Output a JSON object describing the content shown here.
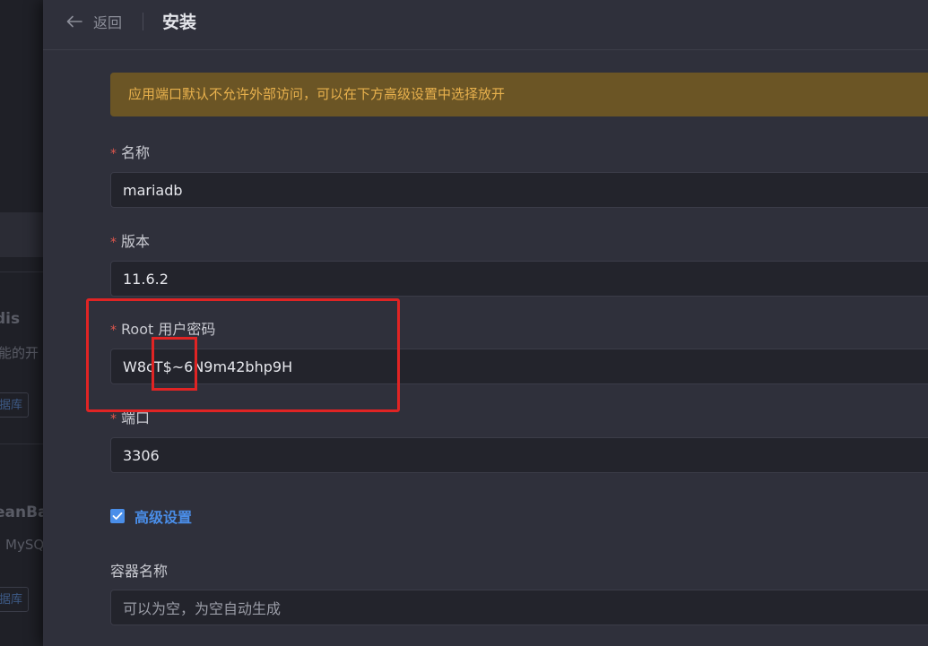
{
  "background_page": {
    "item1_title": "dis",
    "item1_desc": "能的开",
    "item1_tag": "据库",
    "item2_title": "eanBa",
    "item2_desc": "MySQ",
    "item2_tag": "据库"
  },
  "header": {
    "back_label": "返回",
    "title": "安装"
  },
  "alert": {
    "text": "应用端口默认不允许外部访问，可以在下方高级设置中选择放开"
  },
  "form": {
    "required_mark": "*",
    "name_label": "名称",
    "name_value": "mariadb",
    "version_label": "版本",
    "version_value": "11.6.2",
    "root_password_label": "Root 用户密码",
    "root_password_value": "W8cT$~6N9m42bhp9H",
    "port_label": "端口",
    "port_value": "3306",
    "advanced_label": "高级设置",
    "advanced_checked": true,
    "container_name_label": "容器名称",
    "container_name_placeholder": "可以为空，为空自动生成"
  },
  "colors": {
    "accent": "#4a8ee9",
    "warning_text": "#e8b14d",
    "warning_bg": "#6b5525",
    "required": "#e0574d",
    "annotation": "#e02424"
  }
}
